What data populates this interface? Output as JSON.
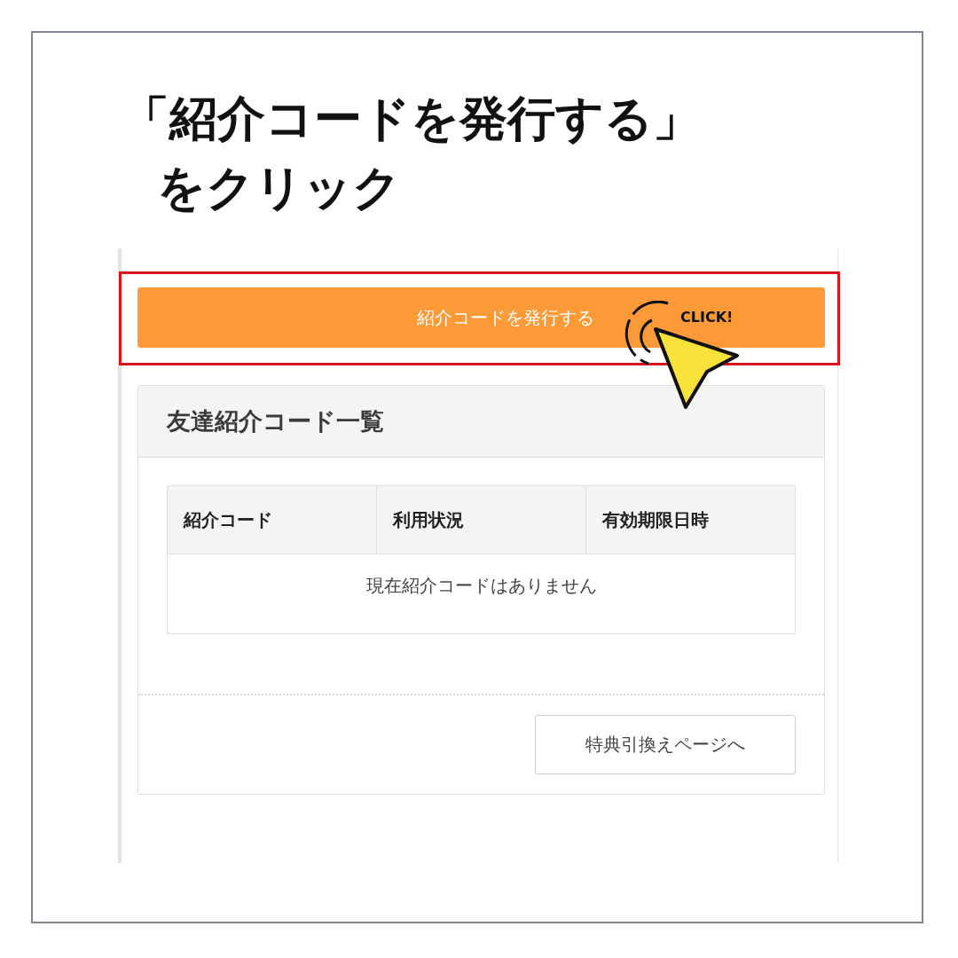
{
  "heading": [
    "「紹介コードを発行する」",
    "をクリック"
  ],
  "issue_button": {
    "label": "紹介コードを発行する",
    "highlighted": true
  },
  "click_callout": {
    "label": "CLICK!"
  },
  "referral_panel": {
    "title": "友達紹介コード一覧",
    "table": {
      "columns": [
        "紹介コード",
        "利用状況",
        "有効期限日時"
      ],
      "empty_message": "現在紹介コードはありません"
    },
    "redeem_button": {
      "label": "特典引換えページへ"
    }
  }
}
